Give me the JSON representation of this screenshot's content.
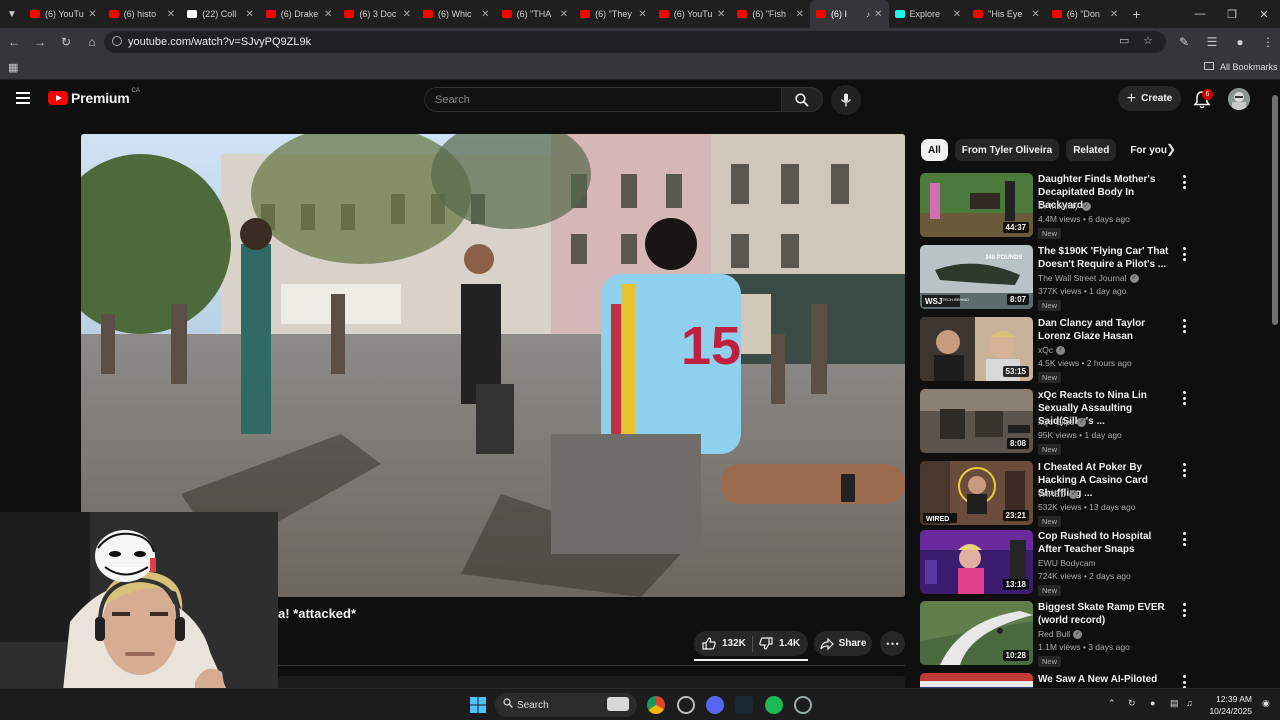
{
  "browser": {
    "tabs": [
      {
        "label": "(6) YouTu",
        "favicon": "youtube"
      },
      {
        "label": "(6) histo",
        "favicon": "youtube"
      },
      {
        "label": "(22) Coll",
        "favicon": "x"
      },
      {
        "label": "(6) Drake",
        "favicon": "youtube"
      },
      {
        "label": "(6) 3 Doc",
        "favicon": "youtube"
      },
      {
        "label": "(6) Whic",
        "favicon": "youtube"
      },
      {
        "label": "(6) \"THA",
        "favicon": "youtube"
      },
      {
        "label": "(6) \"They",
        "favicon": "youtube"
      },
      {
        "label": "(6) YouTu",
        "favicon": "youtube"
      },
      {
        "label": "(6) \"Fish",
        "favicon": "youtube"
      },
      {
        "label": "(6) I",
        "favicon": "youtube",
        "active": true
      },
      {
        "label": "Explore",
        "favicon": "tiktok"
      },
      {
        "label": "\"His Eye",
        "favicon": "youtube"
      },
      {
        "label": "(6) \"Don",
        "favicon": "youtube"
      }
    ],
    "url": "youtube.com/watch?v=SJvyPQ9ZL9k",
    "bookmarks_label": "All Bookmarks"
  },
  "header": {
    "logo_text": "Premium",
    "country": "CA",
    "search_placeholder": "Search",
    "create_label": "Create",
    "notification_count": "6"
  },
  "video": {
    "title_fragment": "a! *attacked*",
    "likes": "132K",
    "dislikes": "1.4K",
    "share_label": "Share"
  },
  "chips": [
    "All",
    "From Tyler Oliveira",
    "Related",
    "For you"
  ],
  "suggestions": [
    {
      "title": "Daughter Finds Mother's Decapitated Body In Backyard",
      "channel": "Dr Insanity",
      "meta": "4.4M views • 6 days ago",
      "badge": "New",
      "duration": "44:37",
      "verified": true
    },
    {
      "title": "The $190K 'Flying Car' That Doesn't Require a Pilot's ...",
      "channel": "The Wall Street Journal",
      "meta": "377K views • 1 day ago",
      "badge": "New",
      "duration": "8:07",
      "verified": true
    },
    {
      "title": "Dan Clancy and Taylor Lorenz Glaze Hasan",
      "channel": "xQc",
      "meta": "4.5K views • 2 hours ago",
      "badge": "New",
      "duration": "53:15",
      "verified": true
    },
    {
      "title": "xQc Reacts to Nina Lin Sexually Assaulting Said(Silky's ...",
      "channel": "xQc Clips",
      "meta": "95K views • 1 day ago",
      "badge": "New",
      "duration": "8:08",
      "verified": true
    },
    {
      "title": "I Cheated At Poker By Hacking A Casino Card Shuffling ...",
      "channel": "WIRED",
      "meta": "532K views • 13 days ago",
      "badge": "New",
      "duration": "23:21",
      "verified": true
    },
    {
      "title": "Cop Rushed to Hospital After Teacher Snaps",
      "channel": "EWU Bodycam",
      "meta": "724K views • 2 days ago",
      "badge": "New",
      "duration": "13:18",
      "verified": false
    },
    {
      "title": "Biggest Skate Ramp EVER (world record)",
      "channel": "Red Bull",
      "meta": "1.1M views • 3 days ago",
      "badge": "New",
      "duration": "10:28",
      "verified": true
    },
    {
      "title": "We Saw A New AI-Piloted",
      "channel": "",
      "meta": "",
      "badge": "",
      "duration": "",
      "verified": false
    }
  ],
  "thumb_texts": {
    "wsj_logo": "WSJ",
    "wsj_sub": "TECH BEHIND",
    "wsj_pounds": "348 POUNDS",
    "wired_logo": "WIRED"
  },
  "taskbar": {
    "search_label": "Search",
    "time": "12:39 AM",
    "date": "10/24/2025"
  },
  "colors": {
    "youtube_red": "#ff0000",
    "chip_active_bg": "#f1f1f1",
    "background": "#0f0f0f"
  }
}
